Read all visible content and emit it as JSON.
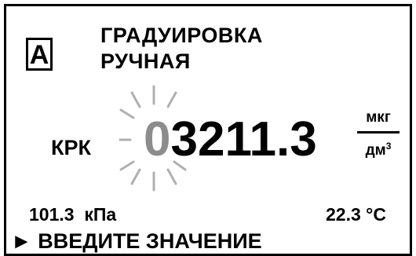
{
  "display": {
    "mode_indicator": "А",
    "title_line1": "ГРАДУИРОВКА",
    "title_line2": "РУЧНАЯ",
    "parameter": "КРК",
    "value": {
      "cursor_digit": "0",
      "rest": "3211.3"
    },
    "unit": {
      "numerator": "мкг",
      "denominator": "дм",
      "denominator_exponent": "3"
    },
    "pressure": "101.3  кПа",
    "temperature": "22.3 °C",
    "prompt": {
      "arrow": "►",
      "text": "ВВЕДИТЕ ЗНАЧЕНИЕ"
    },
    "colors": {
      "text": "#000000",
      "cursor_digit": "#8c8c8c",
      "cursor_rays": "#b0b0b0"
    }
  }
}
